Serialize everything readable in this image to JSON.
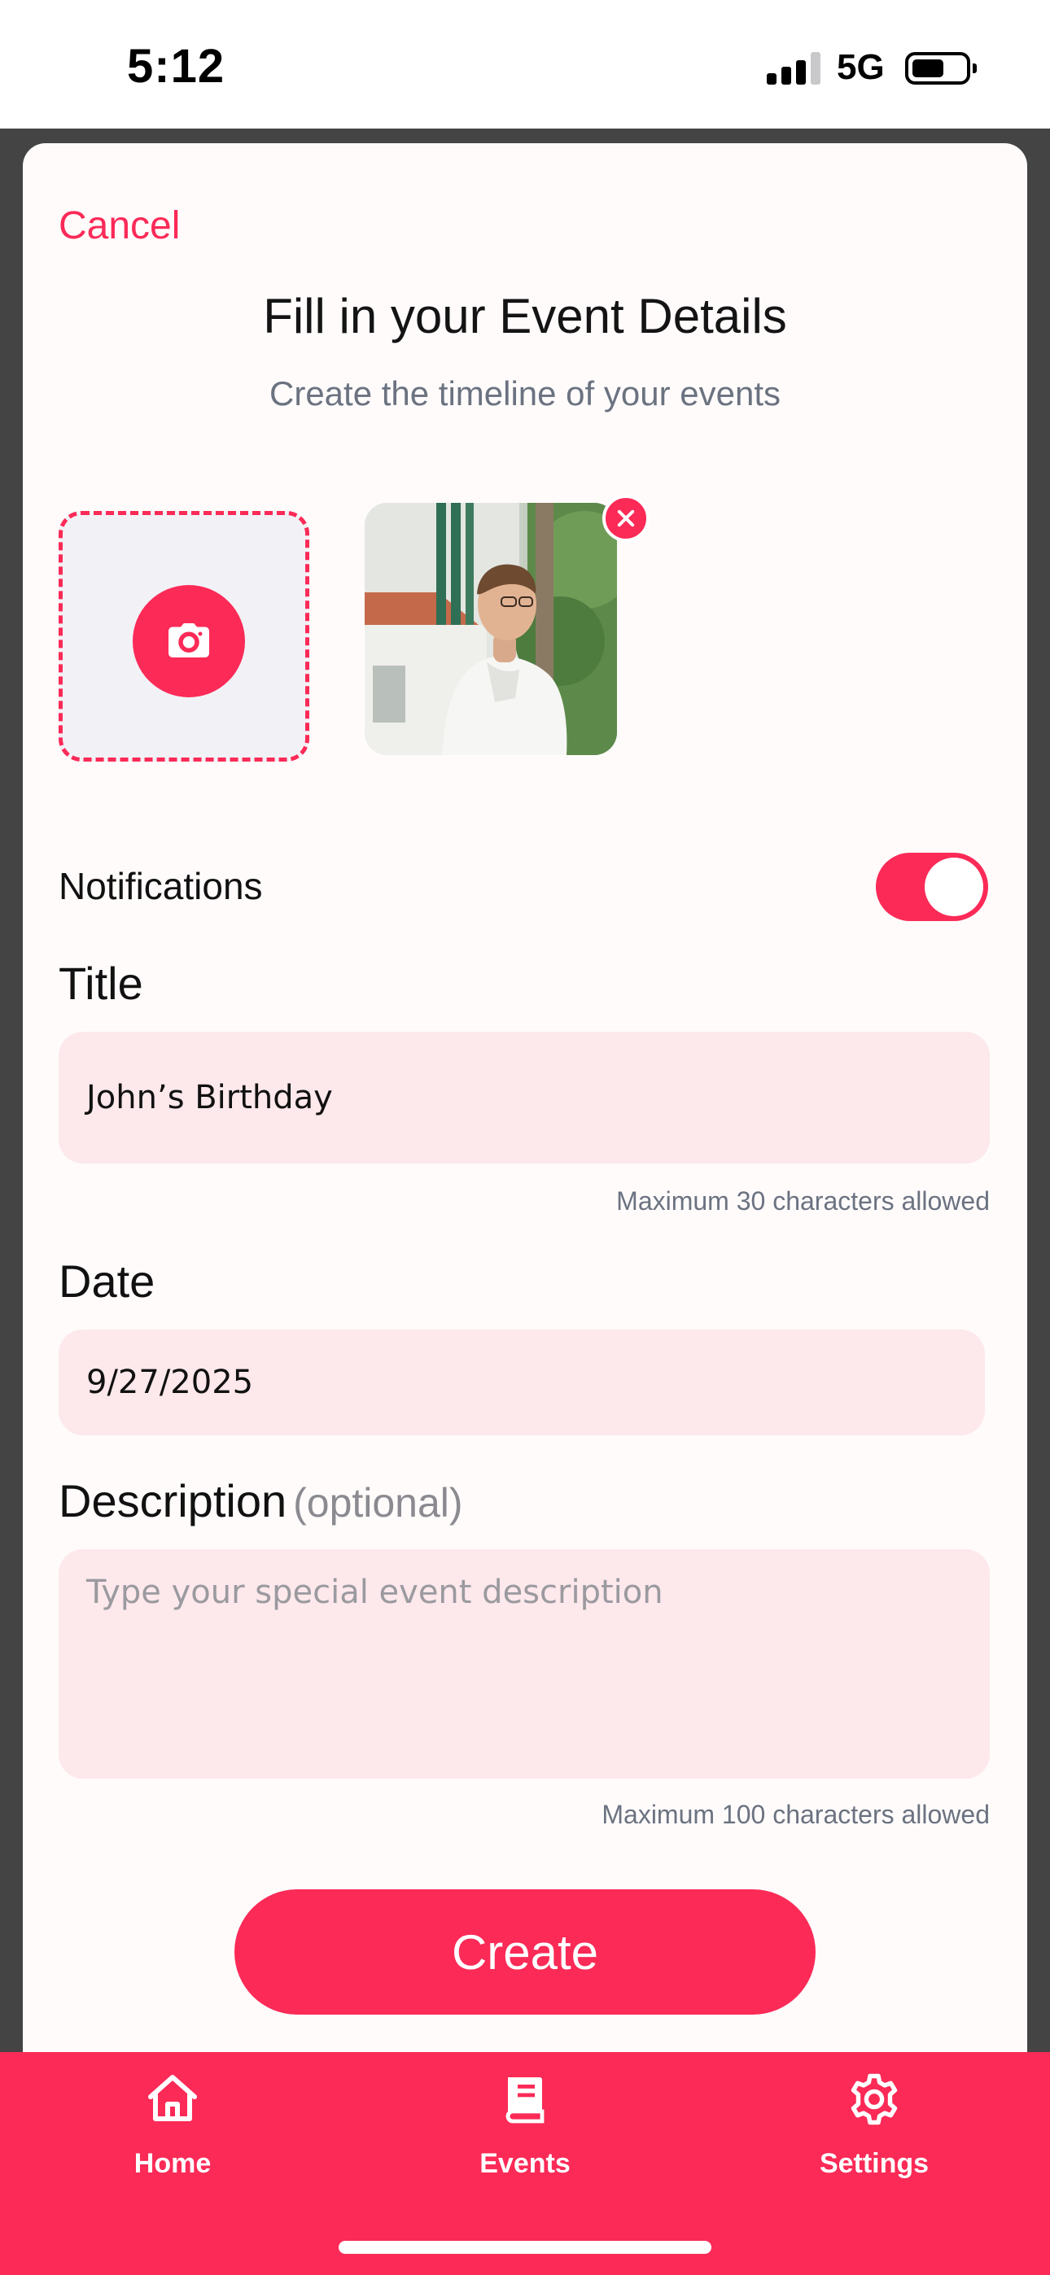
{
  "status_bar": {
    "time": "5:12",
    "network": "5G"
  },
  "header": {
    "cancel_label": "Cancel",
    "title": "Fill in your Event Details",
    "subtitle": "Create the timeline of your events"
  },
  "media": {
    "upload_icon": "camera-icon",
    "photo_icon": "person-photo",
    "remove_icon": "close-icon"
  },
  "notifications": {
    "label": "Notifications",
    "enabled": true
  },
  "form": {
    "title_label": "Title",
    "title_value": "John’s Birthday",
    "title_hint": "Maximum 30 characters allowed",
    "date_label": "Date",
    "date_value": "9/27/2025",
    "description_label": "Description",
    "description_optional": "(optional)",
    "description_placeholder": "Type your special event description",
    "description_hint": "Maximum 100 characters allowed"
  },
  "actions": {
    "create_label": "Create"
  },
  "tabbar": {
    "items": [
      {
        "label": "Home",
        "icon": "home-icon"
      },
      {
        "label": "Events",
        "icon": "book-icon"
      },
      {
        "label": "Settings",
        "icon": "gear-icon"
      }
    ]
  },
  "colors": {
    "accent": "#fb2a57",
    "field_bg": "#fde8ec",
    "backdrop": "#444444",
    "hint_text": "#6b7280"
  }
}
